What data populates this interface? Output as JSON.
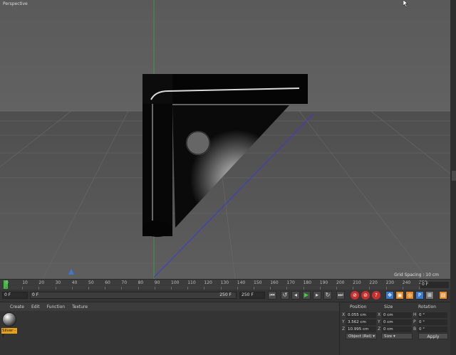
{
  "viewport": {
    "label": "Perspective",
    "grid_spacing": "Grid Spacing : 10 cm"
  },
  "timeline": {
    "ticks": [
      "0",
      "10",
      "20",
      "30",
      "40",
      "50",
      "60",
      "70",
      "80",
      "90",
      "100",
      "110",
      "120",
      "130",
      "140",
      "150",
      "160",
      "170",
      "180",
      "190",
      "200",
      "210",
      "220",
      "230",
      "240",
      "250"
    ],
    "current_frame": "0 F"
  },
  "transport": {
    "start_frame": "0 F",
    "range_start": "0 F",
    "range_end": "250 F",
    "end_frame": "250 F"
  },
  "materials": {
    "menu": [
      "Create",
      "Edit",
      "Function",
      "Texture"
    ],
    "items": [
      {
        "name": "Silver - T",
        "icon": "material-sphere-icon"
      }
    ]
  },
  "coordinates": {
    "headers": {
      "position": "Position",
      "size": "Size",
      "rotation": "Rotation"
    },
    "rows": [
      {
        "axis": "X",
        "position": "0.055 cm",
        "size_axis": "X",
        "size": "0 cm",
        "rot_axis": "H",
        "rotation": "0 °"
      },
      {
        "axis": "Y",
        "position": "3.562 cm",
        "size_axis": "Y",
        "size": "0 cm",
        "rot_axis": "P",
        "rotation": "0 °"
      },
      {
        "axis": "Z",
        "position": "10.995 cm",
        "size_axis": "Z",
        "size": "0 cm",
        "rot_axis": "B",
        "rotation": "0 °"
      }
    ],
    "mode_dropdown": "Object (Rel)",
    "size_dropdown": "Size",
    "apply_label": "Apply"
  }
}
